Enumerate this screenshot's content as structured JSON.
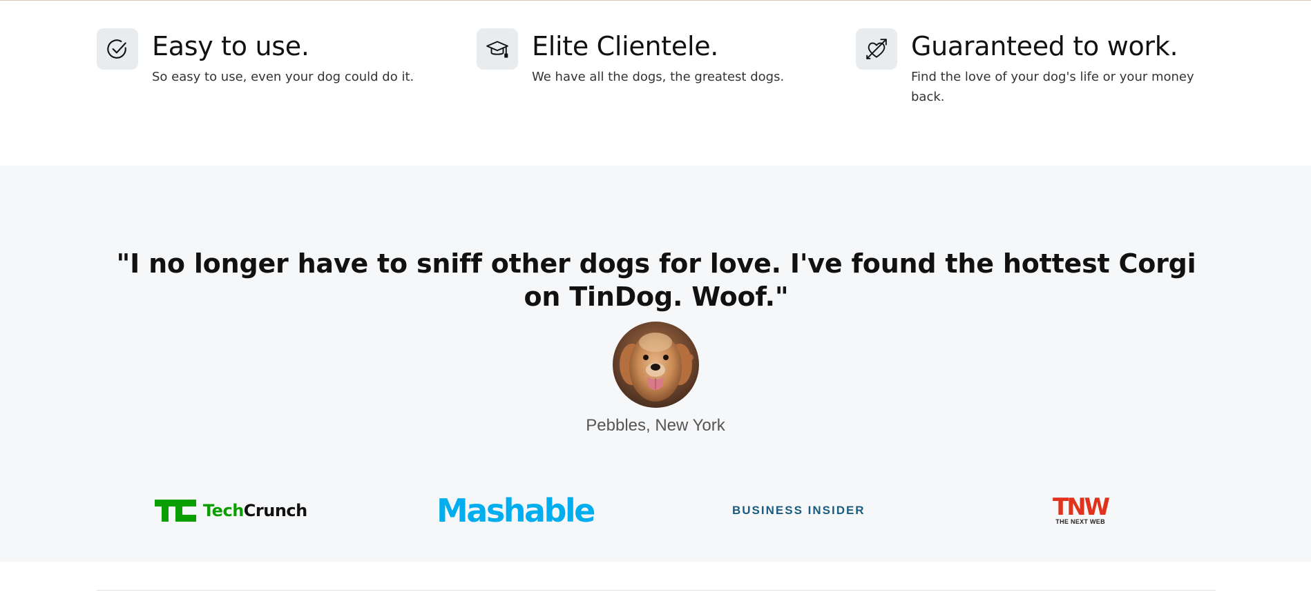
{
  "features": [
    {
      "title": "Easy to use.",
      "description": "So easy to use, even your dog could do it.",
      "icon": "check-circle-icon"
    },
    {
      "title": "Elite Clientele.",
      "description": "We have all the dogs, the greatest dogs.",
      "icon": "mortarboard-icon"
    },
    {
      "title": "Guaranteed to work.",
      "description": "Find the love of your dog's life or your money back.",
      "icon": "heart-arrow-icon"
    }
  ],
  "testimonial": {
    "quote": "\"I no longer have to sniff other dogs for love. I've found the hottest Corgi on TinDog. Woof.\"",
    "author": "Pebbles, New York",
    "avatar": "golden-retriever-avatar"
  },
  "press": {
    "techcrunch": {
      "prefix": "Tech",
      "suffix": "Crunch"
    },
    "mashable": "Mashable",
    "business_insider": "BUSINESS INSIDER",
    "tnw": {
      "mark": "TNW",
      "tagline": "THE NEXT WEB"
    }
  },
  "colors": {
    "section_bg": "#f6f7f9",
    "icon_bg": "#e9ecef",
    "techcrunch_green": "#0a9e01",
    "mashable_blue": "#00aeef",
    "business_insider_blue": "#1a5c80",
    "tnw_red": "#e0331d"
  }
}
